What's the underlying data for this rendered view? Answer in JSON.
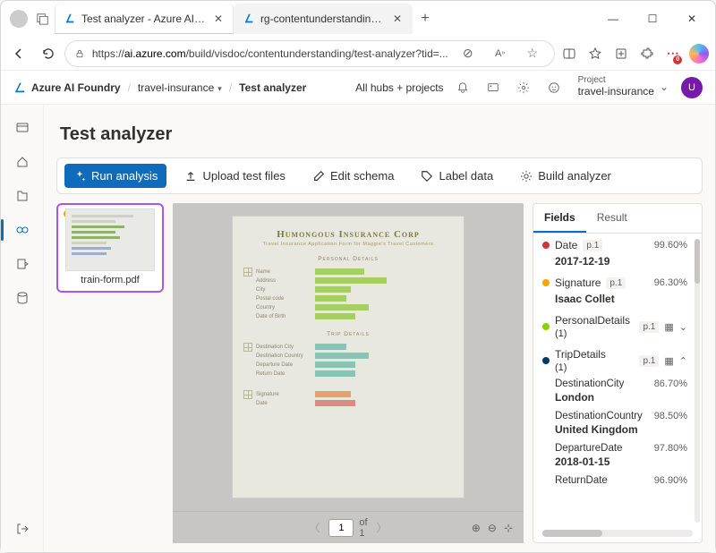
{
  "browser": {
    "tabs": [
      {
        "label": "Test analyzer - Azure AI Foundry",
        "active": true
      },
      {
        "label": "rg-contentunderstandinghub - M",
        "active": false
      }
    ],
    "url_display_prefix": "https://",
    "url_display_host": "ai.azure.com",
    "url_display_path": "/build/visdoc/contentunderstanding/test-analyzer?tid=..."
  },
  "header": {
    "brand": "Azure AI Foundry",
    "crumb_project": "travel-insurance",
    "crumb_page": "Test analyzer",
    "hubs_link": "All hubs + projects",
    "project_label": "Project",
    "project_value": "travel-insurance",
    "user_initial": "U"
  },
  "page": {
    "title": "Test analyzer",
    "toolbar": {
      "run": "Run analysis",
      "upload": "Upload test files",
      "edit": "Edit schema",
      "label": "Label data",
      "build": "Build analyzer"
    },
    "thumbnail": {
      "filename": "train-form.pdf"
    },
    "document": {
      "corp": "Humongous Insurance Corp",
      "subtitle": "Travel Insurance Application Form for Maggie's Travel Customers",
      "section_personal": "Personal Details",
      "section_trip": "Trip Details",
      "labels": {
        "name": "Name",
        "address": "Address",
        "city": "City",
        "postal": "Postal code",
        "country": "Country",
        "dob": "Date of Birth",
        "dest_city": "Destination City",
        "dest_country": "Destination Country",
        "dep": "Departure Date",
        "ret": "Return Date",
        "signature": "Signature",
        "date": "Date"
      },
      "pager": {
        "page": "1",
        "of_label": "of",
        "total": "1"
      }
    },
    "panel": {
      "tab_fields": "Fields",
      "tab_result": "Result",
      "fields": {
        "date": {
          "name": "Date",
          "page": "p.1",
          "pct": "99.60%",
          "value": "2017-12-19"
        },
        "signature": {
          "name": "Signature",
          "page": "p.1",
          "pct": "96.30%",
          "value": "Isaac Collet"
        },
        "personal": {
          "name": "PersonalDetails",
          "count": "(1)",
          "page": "p.1"
        },
        "trip": {
          "name": "TripDetails",
          "count": "(1)",
          "page": "p.1",
          "items": [
            {
              "name": "DestinationCity",
              "pct": "86.70%",
              "value": "London"
            },
            {
              "name": "DestinationCountry",
              "pct": "98.50%",
              "value": "United Kingdom"
            },
            {
              "name": "DepartureDate",
              "pct": "97.80%",
              "value": "2018-01-15"
            },
            {
              "name": "ReturnDate",
              "pct": "96.90%",
              "value": ""
            }
          ]
        }
      }
    }
  }
}
